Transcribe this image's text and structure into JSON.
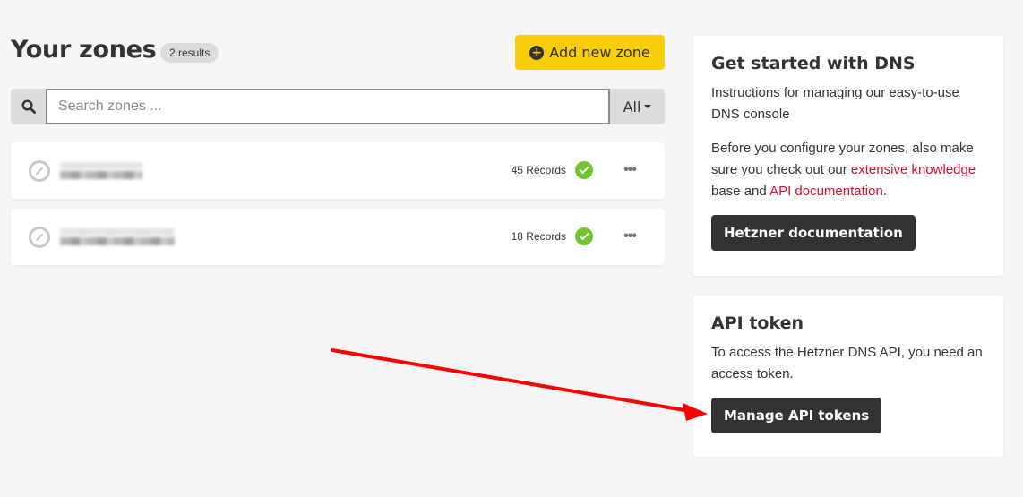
{
  "header": {
    "title": "Your zones",
    "results_badge": "2 results",
    "add_button": "Add new zone"
  },
  "search": {
    "placeholder": "Search zones ...",
    "value": "",
    "filter_label": "All"
  },
  "zones": [
    {
      "name": "(redacted)",
      "records": "45 Records",
      "status": "ok"
    },
    {
      "name": "(redacted)",
      "records": "18 Records",
      "status": "ok"
    }
  ],
  "get_started": {
    "title": "Get started with DNS",
    "intro": "Instructions for managing our easy-to-use DNS console",
    "before": "Before you configure your zones, also make sure you check out our ",
    "link1": "extensive knowledge",
    "middle": " base and ",
    "link2": "API documentation",
    "end": ".",
    "button": "Hetzner documentation"
  },
  "api_token": {
    "title": "API token",
    "text": "To access the Hetzner DNS API, you need an access token.",
    "button": "Manage API tokens"
  },
  "colors": {
    "accent_yellow": "#f7cd0b",
    "link_red": "#d50c2d",
    "status_green": "#72c52f",
    "annotation_arrow": "#ff0000"
  }
}
